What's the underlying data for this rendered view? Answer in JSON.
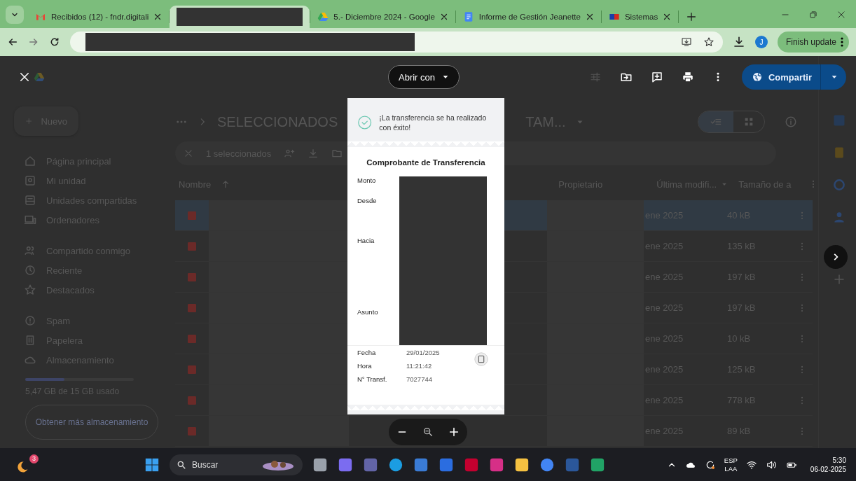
{
  "browser": {
    "tabs": [
      {
        "kind": "page",
        "title": "Recibidos (12) - fndr.digitali",
        "selected": false
      },
      {
        "kind": "redacted",
        "selected": true
      },
      {
        "kind": "page",
        "title": "5.- Diciembre 2024 - Google",
        "selected": false
      },
      {
        "kind": "page",
        "title": "Informe de Gestión Jeanette",
        "selected": false
      },
      {
        "kind": "page",
        "title": "Sistemas",
        "selected": false
      }
    ],
    "avatar": "J",
    "update_button": "Finish update"
  },
  "drive": {
    "new_button": "Nuevo",
    "nav_groups": [
      [
        "Página principal",
        "Mi unidad",
        "Unidades compartidas",
        "Ordenadores"
      ],
      [
        "Compartido conmigo",
        "Reciente",
        "Destacados"
      ],
      [
        "Spam",
        "Papelera",
        "Almacenamiento"
      ]
    ],
    "storage": {
      "level": 0.36,
      "text": "5,47 GB de 15 GB usado",
      "button": "Obtener más almacenamiento"
    },
    "breadcrumb": {
      "current": "SELECCIONADOS",
      "next": "TAM..."
    },
    "selection_bar": {
      "count": "1 seleccionados"
    },
    "columns": [
      "Nombre",
      "Propietario",
      "Última modifi...",
      "Tamaño de a"
    ],
    "rows": [
      {
        "modified": "ene 2025",
        "size": "40 kB",
        "selected": true
      },
      {
        "modified": "ene 2025",
        "size": "135 kB",
        "selected": false
      },
      {
        "modified": "ene 2025",
        "size": "197 kB",
        "selected": false
      },
      {
        "modified": "ene 2025",
        "size": "197 kB",
        "selected": false
      },
      {
        "modified": "ene 2025",
        "size": "10 kB",
        "selected": false
      },
      {
        "modified": "ene 2025",
        "size": "125 kB",
        "selected": false
      },
      {
        "modified": "ene 2025",
        "size": "778 kB",
        "selected": false
      },
      {
        "modified": "ene 2025",
        "size": "89 kB",
        "selected": false
      }
    ]
  },
  "viewer": {
    "open_with": "Abrir con",
    "share": "Compartir",
    "receipt": {
      "banner": "¡La transferencia se ha realizado con éxito!",
      "title": "Comprobante de Transferencia",
      "redacted_labels": [
        "Monto",
        "Desde",
        "Hacia",
        "Asunto"
      ],
      "details": [
        {
          "label": "Fecha",
          "value": "29/01/2025"
        },
        {
          "label": "Hora",
          "value": "11:21:42"
        },
        {
          "label": "N° Transf.",
          "value": "7027744"
        }
      ]
    }
  },
  "taskbar": {
    "badge": "3",
    "search": "Buscar",
    "language": "ESP",
    "layout": "LAA",
    "time": "5:30",
    "date": "06-02-2025"
  }
}
